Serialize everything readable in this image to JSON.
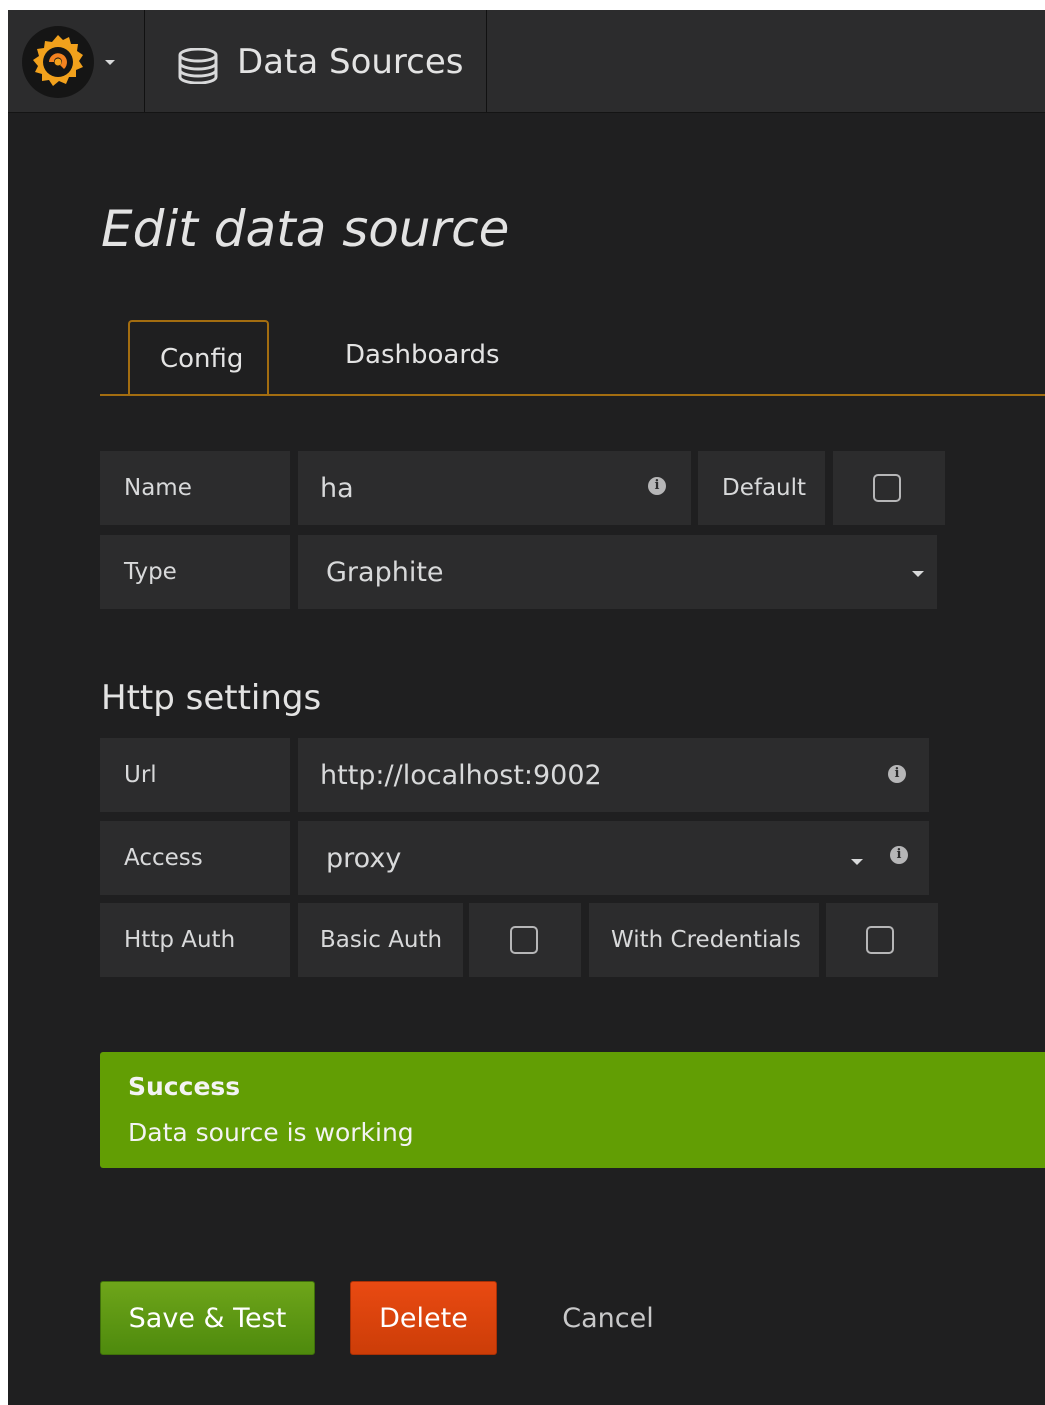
{
  "navbar": {
    "section_title": "Data Sources",
    "logo_icon": "grafana-logo",
    "section_icon": "database-icon"
  },
  "page": {
    "title": "Edit data source"
  },
  "tabs": [
    {
      "label": "Config",
      "active": true
    },
    {
      "label": "Dashboards",
      "active": false
    }
  ],
  "form": {
    "name_label": "Name",
    "name_value": "ha",
    "default_label": "Default",
    "default_checked": false,
    "type_label": "Type",
    "type_value": "Graphite"
  },
  "http": {
    "heading": "Http settings",
    "url_label": "Url",
    "url_value": "http://localhost:9002",
    "access_label": "Access",
    "access_value": "proxy",
    "auth_label": "Http Auth",
    "basic_auth_label": "Basic Auth",
    "basic_auth_checked": false,
    "with_credentials_label": "With Credentials",
    "with_credentials_checked": false
  },
  "alert": {
    "title": "Success",
    "message": "Data source is working",
    "color": "#629e04"
  },
  "actions": {
    "save_label": "Save & Test",
    "delete_label": "Delete",
    "cancel_label": "Cancel"
  },
  "colors": {
    "accent": "#a36d10",
    "success": "#629e04",
    "danger": "#e94a12",
    "background": "#1f1f20",
    "panel": "#2c2c2d"
  }
}
